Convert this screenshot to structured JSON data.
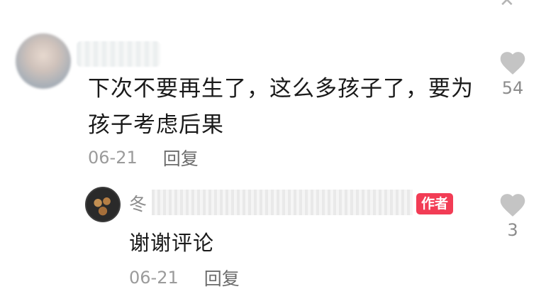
{
  "comment": {
    "text": "下次不要再生了，这么多孩子了，要为孩子考虑后果",
    "date": "06-21",
    "reply_label": "回复",
    "like_count": "54"
  },
  "reply": {
    "author_name_visible": "冬",
    "author_badge": "作者",
    "text": "谢谢评论",
    "date": "06-21",
    "reply_label": "回复",
    "like_count": "3"
  },
  "colors": {
    "badge": "#f23c55",
    "meta": "#9b9b9b",
    "heart": "#c4c4c4"
  },
  "icons": {
    "like": "heart-icon",
    "close": "close-icon"
  }
}
